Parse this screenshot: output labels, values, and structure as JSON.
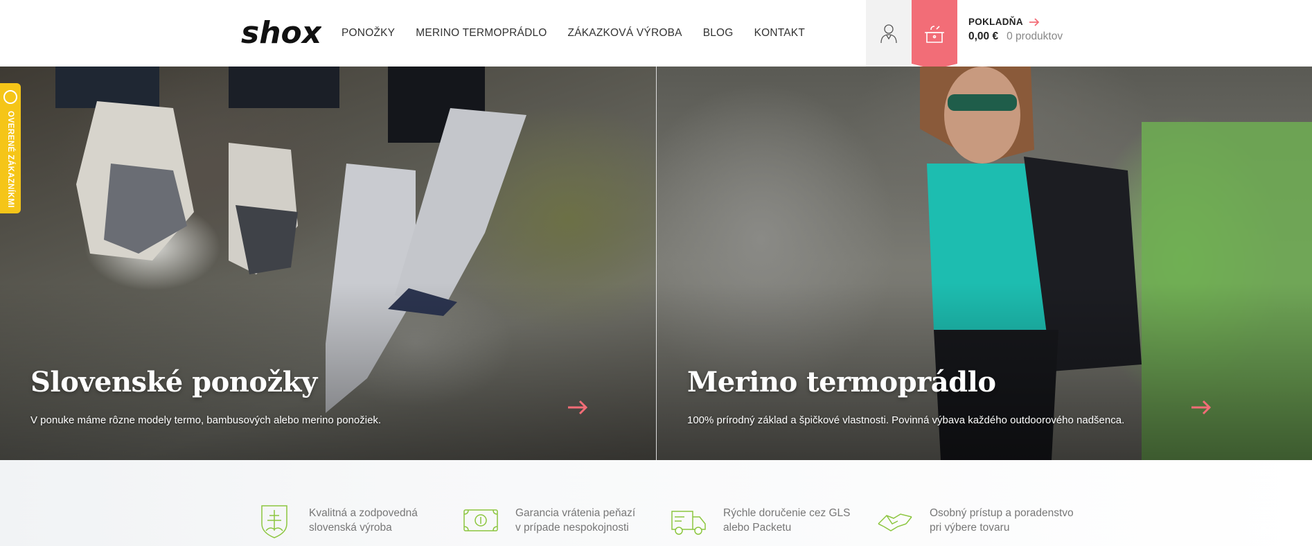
{
  "brand": {
    "logo_text": "shox"
  },
  "nav": {
    "items": [
      "PONOŽKY",
      "MERINO TERMOPRÁDLO",
      "ZÁKAZKOVÁ VÝROBA",
      "BLOG",
      "KONTAKT"
    ]
  },
  "cart": {
    "title": "POKLADŇA",
    "price": "0,00 €",
    "count": "0 produktov"
  },
  "reviews_badge": {
    "label": "OVERENÉ ZÁKAZNÍKMI"
  },
  "hero": [
    {
      "title": "Slovenské ponožky",
      "subtitle": "V ponuke máme rôzne modely termo, bambusových alebo merino ponožiek."
    },
    {
      "title": "Merino termoprádlo",
      "subtitle": "100% prírodný základ a špičkové vlastnosti. Povinná výbava každého outdoorového nadšenca."
    }
  ],
  "features": [
    {
      "icon": "slovak-emblem-icon",
      "line1": "Kvalitná a zodpovedná",
      "line2": "slovenská výroba"
    },
    {
      "icon": "money-icon",
      "line1": "Garancia vrátenia peňazí",
      "line2": "v prípade nespokojnosti"
    },
    {
      "icon": "delivery-truck-icon",
      "line1": "Rýchle doručenie cez GLS",
      "line2": "alebo Packetu"
    },
    {
      "icon": "handshake-icon",
      "line1": "Osobný prístup a poradenstvo",
      "line2": "pri výbere tovaru"
    }
  ],
  "colors": {
    "accent": "#f26d77",
    "badge": "#f5c518",
    "feature_icon": "#8cc63f"
  }
}
